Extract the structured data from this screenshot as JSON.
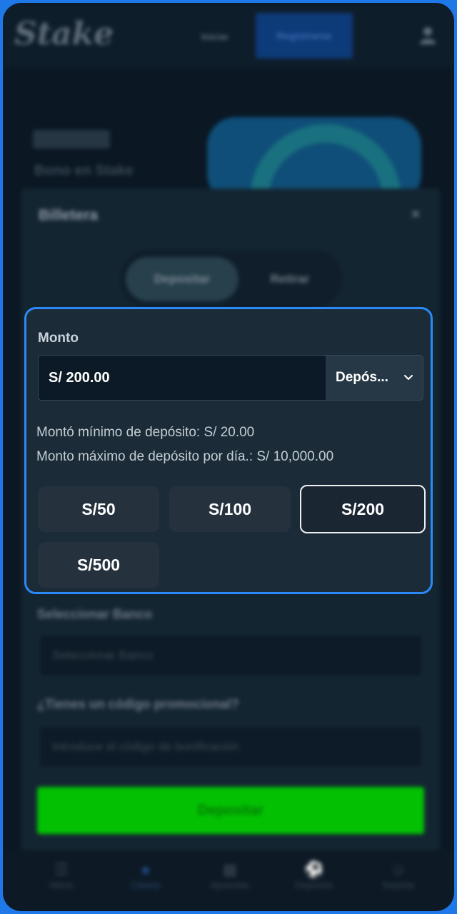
{
  "header": {
    "logo_text": "Stake",
    "login_label": "Iniciar",
    "register_label": "Registrarse"
  },
  "promo": {
    "text": "Bono en Stake"
  },
  "wallet": {
    "title": "Billetera",
    "close_glyph": "×",
    "tabs": {
      "deposit": "Depositar",
      "withdraw": "Retirar"
    },
    "amount": {
      "label": "Monto",
      "value": "S/ 200.00",
      "method_label": "Depós...",
      "min_text": "Montó mínimo de depósito: S/ 20.00",
      "max_text": "Monto máximo de depósito por día.: S/ 10,000.00",
      "quick_amounts": [
        "S/50",
        "S/100",
        "S/200",
        "S/500"
      ],
      "selected_amount": "S/200"
    },
    "bank": {
      "label": "Seleccionar Banco",
      "placeholder": "Seleccionar Banco"
    },
    "promo_code": {
      "label": "¿Tienes un código promocional?",
      "placeholder": "Introduce el código de bonificación"
    },
    "submit_label": "Depositar"
  },
  "bottom_nav": {
    "items": [
      {
        "label": "Menú",
        "glyph": "☰"
      },
      {
        "label": "Casino",
        "glyph": "♠"
      },
      {
        "label": "Apuestas",
        "glyph": "▦"
      },
      {
        "label": "Deportes",
        "glyph": "⚽"
      },
      {
        "label": "Soporte",
        "glyph": "☺"
      }
    ],
    "active_index": 1
  },
  "colors": {
    "highlight_border": "#2b8af7",
    "deposit_green": "#03c003",
    "page_background": "#1f78e8"
  }
}
